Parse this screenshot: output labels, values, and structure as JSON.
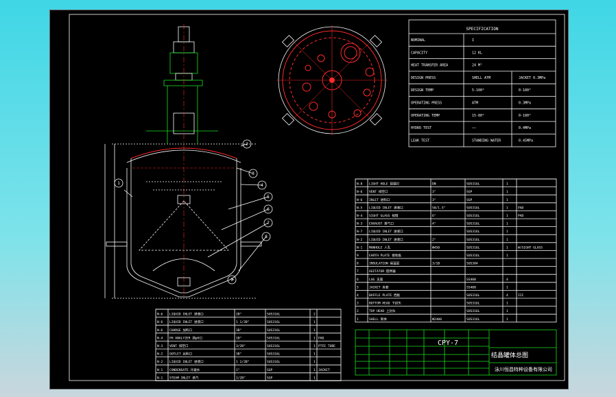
{
  "spec": {
    "title": "SPECIFICATION",
    "rows": [
      {
        "label": "NOMINAL",
        "v1": "I",
        "v2": ""
      },
      {
        "label": "CAPACITY",
        "v1": "12 KL",
        "v2": ""
      },
      {
        "label": "HEAT TRANSFER AREA",
        "v1": "24 M²",
        "v2": ""
      },
      {
        "label": "DESIGN PRESS",
        "v1": "SHELL ATM",
        "v2": "JACKET 0.3MPa"
      },
      {
        "label": "DESIGN TEMP",
        "v1": "5-100°",
        "v2": "0-180°"
      },
      {
        "label": "OPERATING PRESS",
        "v1": "ATM",
        "v2": "0.3MPa"
      },
      {
        "label": "OPERATING TEMP",
        "v1": "15-80°",
        "v2": "0-180°"
      },
      {
        "label": "HYDRO TEST",
        "v1": "——",
        "v2": "0.4MPa"
      },
      {
        "label": "LEAK TEST",
        "v1": "STANDING WATER",
        "v2": "0.45MPa"
      }
    ]
  },
  "nozzles_right": [
    {
      "no": "N-8",
      "desc": "LIGHT HOLE 视镜灯",
      "size": "DN",
      "mat": "SUS316L",
      "qty": "1",
      "note": ""
    },
    {
      "no": "N-6",
      "desc": "VENT 排空口",
      "size": "3\"",
      "mat": "SGP",
      "qty": "1",
      "note": ""
    },
    {
      "no": "N-6",
      "desc": "INLET 进料口",
      "size": "3\"",
      "mat": "SGP",
      "qty": "1",
      "note": ""
    },
    {
      "no": "N-5",
      "desc": "LIQUID INLET 进液口",
      "size": "50/1.5\"",
      "mat": "SUS316L",
      "qty": "1",
      "note": "PAD"
    },
    {
      "no": "N-4",
      "desc": "SIGHT GLASS 视镜",
      "size": "6\"",
      "mat": "SUS316L",
      "qty": "1",
      "note": "PAD"
    },
    {
      "no": "N-3",
      "desc": "EXHAUST 排气口",
      "size": "4\"",
      "mat": "SUS316L",
      "qty": "1",
      "note": ""
    },
    {
      "no": "N-7",
      "desc": "LIQUID INLET 进液口",
      "size": "",
      "mat": "SUS316L",
      "qty": "1",
      "note": ""
    },
    {
      "no": "N-2",
      "desc": "LIQUID INLET 进液口",
      "size": "2\"",
      "mat": "SUS316L",
      "qty": "1",
      "note": ""
    },
    {
      "no": "N-1",
      "desc": "MANHOLE 人孔",
      "size": "Φ450",
      "mat": "SUS316L",
      "qty": "1",
      "note": "W/SIGHT GLASS"
    }
  ],
  "parts": [
    {
      "no": "9",
      "desc": "EARTH PLATE 接地板",
      "size": "",
      "mat": "SUS316L",
      "qty": "1",
      "note": ""
    },
    {
      "no": "8",
      "desc": "INSULATION 保温层",
      "size": "3/1B",
      "mat": "SUS304",
      "qty": "",
      "note": ""
    },
    {
      "no": "7",
      "desc": "AGITATOR 搅拌器",
      "size": "",
      "mat": "",
      "qty": "",
      "note": ""
    },
    {
      "no": "6",
      "desc": "LUG 支座",
      "size": "",
      "mat": "SS400",
      "qty": "4",
      "note": ""
    },
    {
      "no": "5",
      "desc": "JACKET 夹套",
      "size": "",
      "mat": "SS400",
      "qty": "1",
      "note": ""
    },
    {
      "no": "4",
      "desc": "BAFFLE PLATE 挡板",
      "size": "",
      "mat": "SUS316L",
      "qty": "4",
      "note": "III"
    },
    {
      "no": "3",
      "desc": "BOTTOM HEAD 下封头",
      "size": "",
      "mat": "SUS316L",
      "qty": "1",
      "note": ""
    },
    {
      "no": "2",
      "desc": "TOP HEAD 上封头",
      "size": "",
      "mat": "SUS316L",
      "qty": "1",
      "note": ""
    },
    {
      "no": "1",
      "desc": "SHELL 筒体",
      "size": "Φ2400",
      "mat": "SUS316L",
      "qty": "1",
      "note": ""
    }
  ],
  "nozzles_left": [
    {
      "no": "N-6",
      "desc": "LIQUID INLET 进液口",
      "size": "2B\"",
      "mat": "SUS316L",
      "qty": "2",
      "note": ""
    },
    {
      "no": "N-6",
      "desc": "LIQUID INLET 进液口",
      "size": "1 1/2B\"",
      "mat": "SUS316L",
      "qty": "1",
      "note": ""
    },
    {
      "no": "N-6",
      "desc": "CHARGE 加料口",
      "size": "3B\"",
      "mat": "SUS316L",
      "qty": "1",
      "note": ""
    },
    {
      "no": "N-4",
      "desc": "PH ANALYZER 测pH口",
      "size": "1B\"",
      "mat": "SUS316L",
      "qty": "1",
      "note": "PAD"
    },
    {
      "no": "N-3",
      "desc": "VENT 排空口",
      "size": "3/2B\"",
      "mat": "SUS316L",
      "qty": "1",
      "note": "PTFE TUBE"
    },
    {
      "no": "N-2",
      "desc": "OUTLET 出料口",
      "size": "3B\"",
      "mat": "SUS316L",
      "qty": "1",
      "note": ""
    },
    {
      "no": "N-2",
      "desc": "LIQUID INLET 进液口",
      "size": "1 1/2B\"",
      "mat": "SUS316L",
      "qty": "1",
      "note": ""
    },
    {
      "no": "N-1",
      "desc": "CONDENSATE 冷凝水",
      "size": "1\"",
      "mat": "SGP",
      "qty": "1",
      "note": "JACKET"
    },
    {
      "no": "N-1",
      "desc": "STEAM INLET 进汽",
      "size": "1/2B\"",
      "mat": "SGP",
      "qty": "1",
      "note": ""
    }
  ],
  "title_block": {
    "drawing_no": "CPY-7",
    "drawing_title": "结晶罐体总图",
    "company": "泳川恒昌特种设备有限公司"
  },
  "callouts": [
    "1",
    "2",
    "3",
    "4",
    "5",
    "6",
    "7",
    "8",
    "9"
  ],
  "colors": {
    "background": "#000000",
    "lines": "#ffffff",
    "accent_green": "#19e01f",
    "accent_red": "#ff2a2a",
    "frame_bg": "#3fd6e6"
  }
}
